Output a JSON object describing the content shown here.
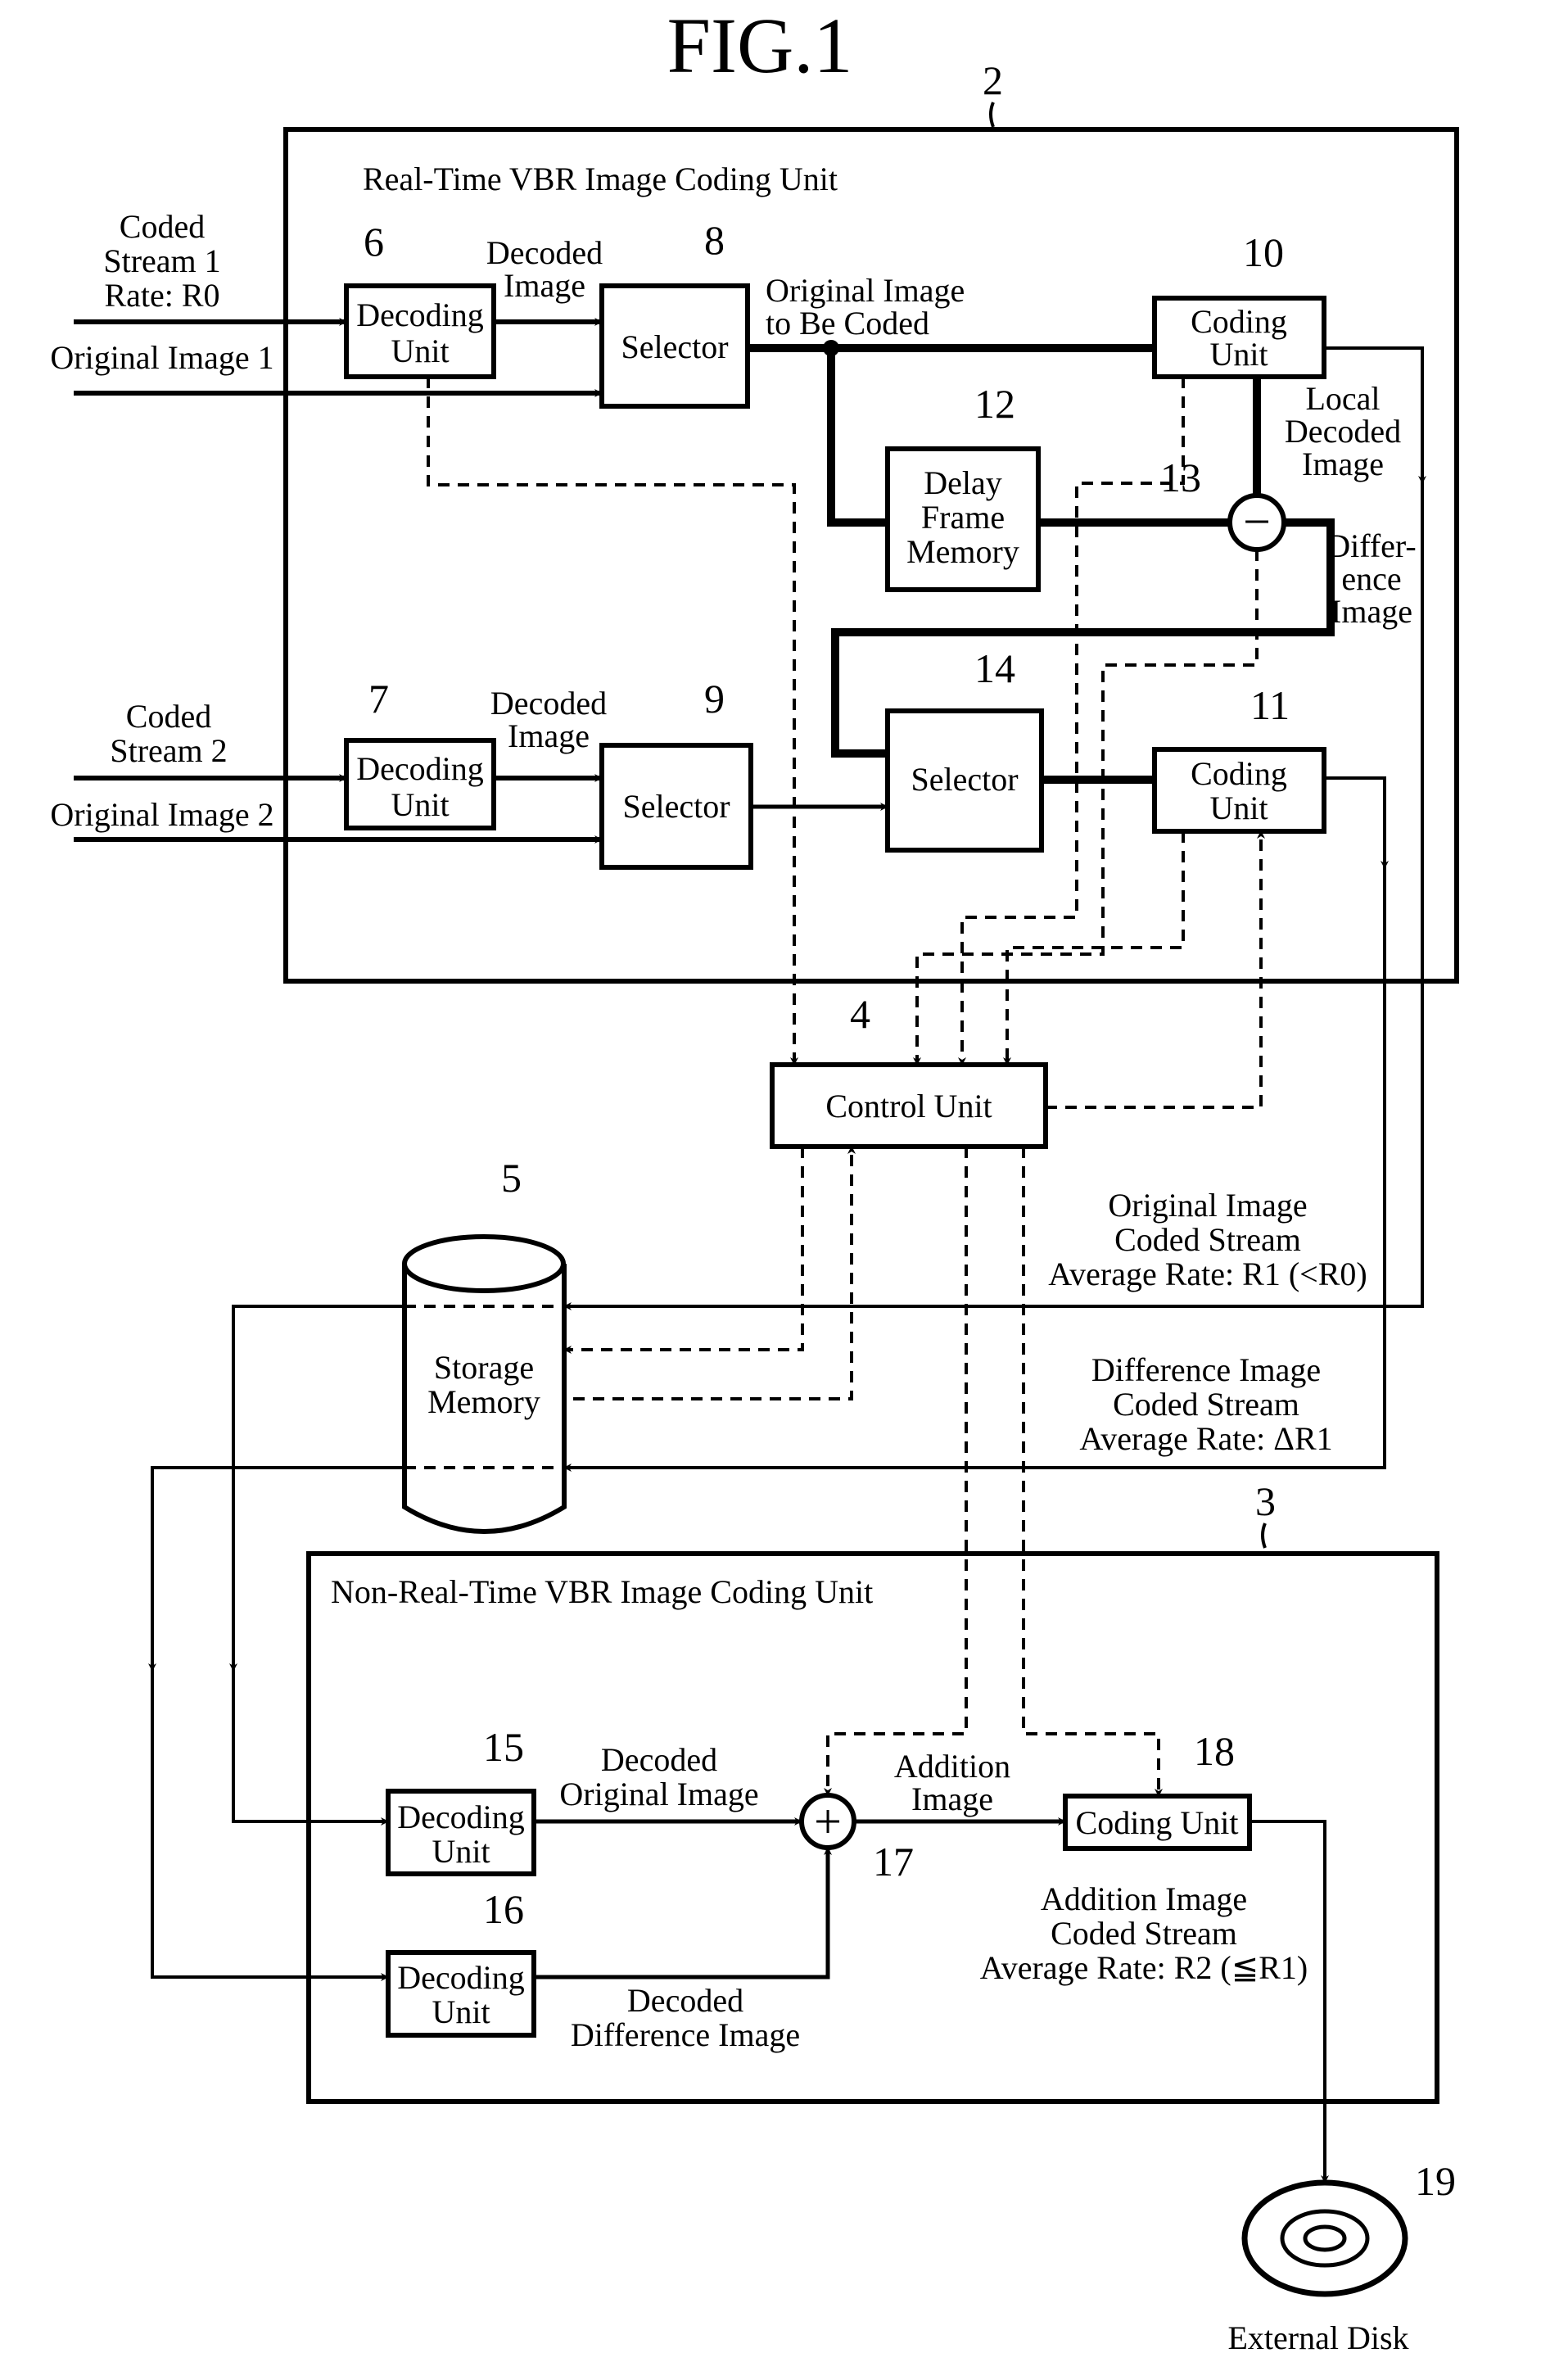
{
  "figure": {
    "title": "FIG.1"
  },
  "units": {
    "realtime": {
      "ref": "2",
      "label": "Real-Time VBR Image Coding Unit"
    },
    "nonrealtime": {
      "ref": "3",
      "label": "Non-Real-Time VBR Image Coding Unit"
    },
    "control": {
      "ref": "4",
      "label": "Control Unit"
    },
    "storage": {
      "ref": "5",
      "line1": "Storage",
      "line2": "Memory"
    },
    "decoding6": {
      "ref": "6",
      "line1": "Decoding",
      "line2": "Unit"
    },
    "decoding7": {
      "ref": "7",
      "line1": "Decoding",
      "line2": "Unit"
    },
    "selector8": {
      "ref": "8",
      "label": "Selector"
    },
    "selector9": {
      "ref": "9",
      "label": "Selector"
    },
    "coding10": {
      "ref": "10",
      "line1": "Coding",
      "line2": "Unit"
    },
    "coding11": {
      "ref": "11",
      "line1": "Coding",
      "line2": "Unit"
    },
    "delay12": {
      "ref": "12",
      "line1": "Delay",
      "line2": "Frame",
      "line3": "Memory"
    },
    "subtractor13": {
      "ref": "13",
      "symbol": "−"
    },
    "selector14": {
      "ref": "14",
      "label": "Selector"
    },
    "decoding15": {
      "ref": "15",
      "line1": "Decoding",
      "line2": "Unit"
    },
    "decoding16": {
      "ref": "16",
      "line1": "Decoding",
      "line2": "Unit"
    },
    "adder17": {
      "ref": "17",
      "symbol": "+"
    },
    "coding18": {
      "ref": "18",
      "label": "Coding Unit"
    },
    "disk19": {
      "ref": "19",
      "label": "External Disk"
    }
  },
  "signals": {
    "coded_stream_1": [
      "Coded",
      "Stream 1",
      "Rate: R0"
    ],
    "original_image_1": "Original Image 1",
    "coded_stream_2": [
      "Coded",
      "Stream 2"
    ],
    "original_image_2": "Original Image 2",
    "decoded_image_1": [
      "Decoded",
      "Image"
    ],
    "decoded_image_2": [
      "Decoded",
      "Image"
    ],
    "original_to_code": [
      "Original Image",
      "to Be Coded"
    ],
    "local_decoded": [
      "Local",
      "Decoded",
      "Image"
    ],
    "difference_image": [
      "Differ-",
      "ence",
      "Image"
    ],
    "orig_coded_stream": [
      "Original Image",
      "Coded Stream",
      "Average Rate: R1 (<R0)"
    ],
    "diff_coded_stream": [
      "Difference Image",
      "Coded Stream",
      "Average Rate: ΔR1"
    ],
    "decoded_original": [
      "Decoded",
      "Original Image"
    ],
    "decoded_difference": [
      "Decoded",
      "Difference Image"
    ],
    "addition_image": [
      "Addition",
      "Image"
    ],
    "addition_coded_stream": [
      "Addition Image",
      "Coded Stream",
      "Average Rate: R2 (≦R1)"
    ]
  }
}
